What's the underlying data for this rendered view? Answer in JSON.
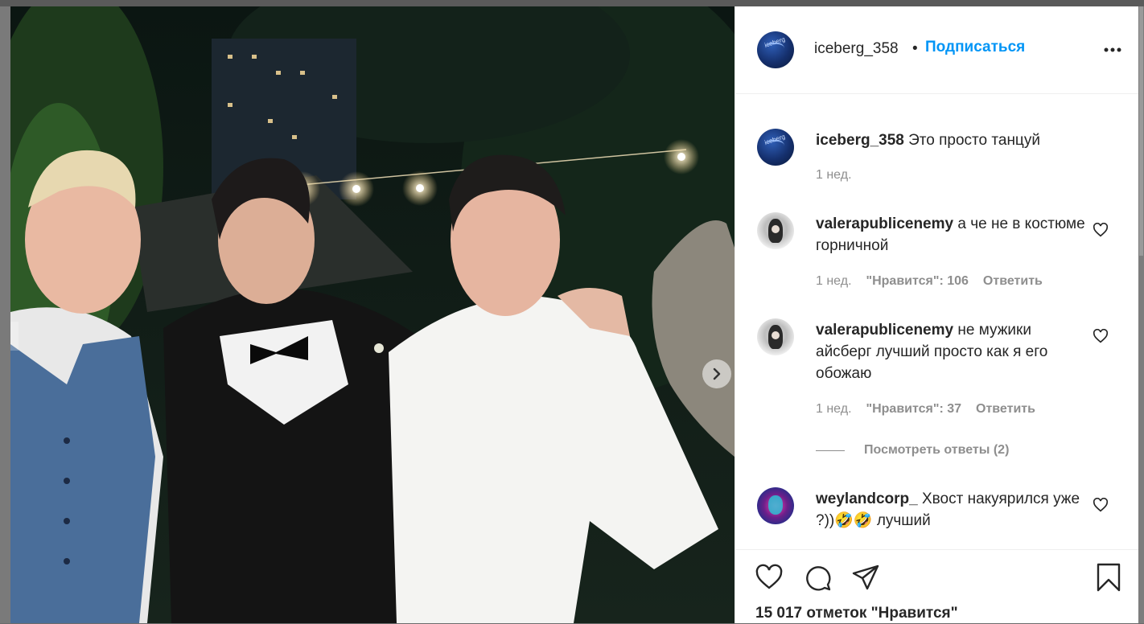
{
  "post": {
    "username": "iceberg_358",
    "dot": "•",
    "follow_label": "Подписаться",
    "likes_text": "15 017 отметок \"Нравится\""
  },
  "caption": {
    "username": "iceberg_358",
    "text": "Это просто танцуй",
    "time": "1 нед."
  },
  "comments": [
    {
      "username": "valerapublicenemy",
      "text": "а че не в костюме горничной",
      "time": "1 нед.",
      "likes": "\"Нравится\": 106",
      "reply": "Ответить"
    },
    {
      "username": "valerapublicenemy",
      "text": "не мужики айсберг лучший просто как я его обожаю",
      "time": "1 нед.",
      "likes": "\"Нравится\": 37",
      "reply": "Ответить",
      "view_replies": "Посмотреть ответы (2)"
    },
    {
      "username": "weylandcorp_",
      "text": "Хвост накуярился уже ?))🤣🤣 лучший"
    }
  ],
  "avatar_label": "iceberg",
  "colors": {
    "link_blue": "#0095f6",
    "text": "#262626",
    "meta": "#8e8e8e"
  },
  "icons": [
    "more-icon",
    "heart-icon",
    "comment-icon",
    "share-icon",
    "bookmark-icon",
    "chevron-right-icon"
  ]
}
